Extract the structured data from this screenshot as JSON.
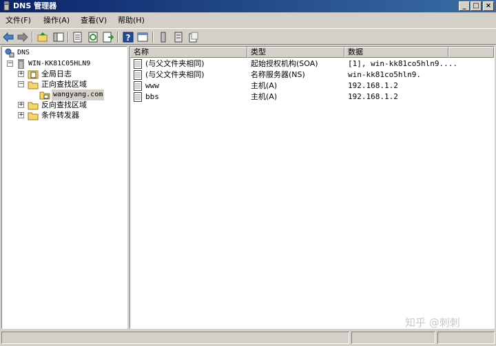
{
  "window": {
    "title": "DNS 管理器",
    "minimize": "_",
    "maximize": "□",
    "close": "×"
  },
  "menu": {
    "items": [
      "文件(F)",
      "操作(A)",
      "查看(V)",
      "帮助(H)"
    ]
  },
  "toolbar": {
    "buttons": [
      "back-icon",
      "forward-icon",
      "up-folder-icon",
      "show-hide-tree-icon",
      "export-list-icon",
      "refresh-icon",
      "export-icon",
      "help-icon",
      "properties-view-icon",
      "server-icon",
      "list-icon",
      "zone-icon"
    ]
  },
  "tree": {
    "root": "DNS",
    "server": "WIN-KK81C05HLN9",
    "global_logs": "全局日志",
    "forward_zones": "正向查找区域",
    "zone": "wangyang.com",
    "reverse_zones": "反向查找区域",
    "conditional_forwarders": "条件转发器"
  },
  "list": {
    "columns": [
      "名称",
      "类型",
      "数据"
    ],
    "rows": [
      {
        "name": "(与父文件夹相同)",
        "type": "起始授权机构(SOA)",
        "data": "[1], win-kk81co5hln9...."
      },
      {
        "name": "(与父文件夹相同)",
        "type": "名称服务器(NS)",
        "data": "win-kk81co5hln9."
      },
      {
        "name": "www",
        "type": "主机(A)",
        "data": "192.168.1.2"
      },
      {
        "name": "bbs",
        "type": "主机(A)",
        "data": "192.168.1.2"
      }
    ]
  },
  "watermark": "知乎 @刺刺",
  "colors": {
    "titlebar_start": "#0a246a",
    "titlebar_end": "#3a6ea5",
    "window_face": "#d4d0c8",
    "folder": "#f5d66a"
  }
}
